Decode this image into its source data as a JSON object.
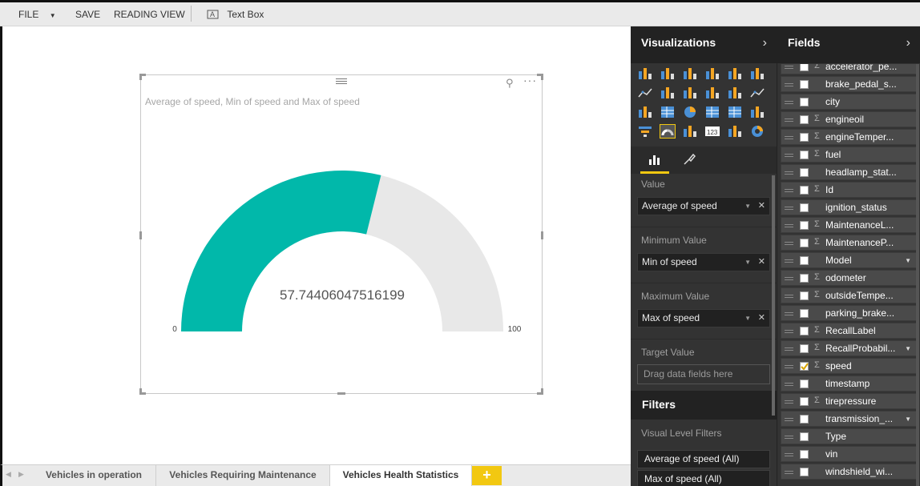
{
  "toolbar": {
    "file_label": "FILE",
    "save_label": "SAVE",
    "reading_view_label": "READING VIEW",
    "textbox_label": "Text Box"
  },
  "visual": {
    "title": "Average of speed, Min of speed and Max of speed",
    "gauge": {
      "value": 57.74406047516199,
      "value_label": "57.74406047516199",
      "min": 0,
      "max": 100,
      "min_label": "0",
      "max_label": "100",
      "fill_color": "#01b8aa",
      "track_color": "#e8e8e8"
    }
  },
  "tabs": {
    "items": [
      "Vehicles in operation",
      "Vehicles Requiring Maintenance",
      "Vehicles Health Statistics"
    ],
    "active_index": 2,
    "add_label": "+"
  },
  "visualizations": {
    "title": "Visualizations",
    "chevron": "›",
    "value_label": "Value",
    "value_field": "Average of speed",
    "min_label": "Minimum Value",
    "min_field": "Min of speed",
    "max_label": "Maximum Value",
    "max_field": "Max of speed",
    "target_label": "Target Value",
    "target_placeholder": "Drag data fields here",
    "filters_title": "Filters",
    "visual_level_label": "Visual Level Filters",
    "filters": [
      "Average of speed (All)",
      "Max of speed (All)"
    ]
  },
  "fields": {
    "title": "Fields",
    "chevron": "›",
    "items": [
      {
        "name": "accelerator_pe...",
        "sigma": true,
        "checked": false,
        "expand": false
      },
      {
        "name": "brake_pedal_s...",
        "sigma": false,
        "checked": false,
        "expand": false
      },
      {
        "name": "city",
        "sigma": false,
        "checked": false,
        "expand": false
      },
      {
        "name": "engineoil",
        "sigma": true,
        "checked": false,
        "expand": false
      },
      {
        "name": "engineTemper...",
        "sigma": true,
        "checked": false,
        "expand": false
      },
      {
        "name": "fuel",
        "sigma": true,
        "checked": false,
        "expand": false
      },
      {
        "name": "headlamp_stat...",
        "sigma": false,
        "checked": false,
        "expand": false
      },
      {
        "name": "Id",
        "sigma": true,
        "checked": false,
        "expand": false
      },
      {
        "name": "ignition_status",
        "sigma": false,
        "checked": false,
        "expand": false
      },
      {
        "name": "MaintenanceL...",
        "sigma": true,
        "checked": false,
        "expand": false
      },
      {
        "name": "MaintenanceP...",
        "sigma": true,
        "checked": false,
        "expand": false
      },
      {
        "name": "Model",
        "sigma": false,
        "checked": false,
        "expand": true
      },
      {
        "name": "odometer",
        "sigma": true,
        "checked": false,
        "expand": false
      },
      {
        "name": "outsideTempe...",
        "sigma": true,
        "checked": false,
        "expand": false
      },
      {
        "name": "parking_brake...",
        "sigma": false,
        "checked": false,
        "expand": false
      },
      {
        "name": "RecallLabel",
        "sigma": true,
        "checked": false,
        "expand": false
      },
      {
        "name": "RecallProbabil...",
        "sigma": true,
        "checked": false,
        "expand": true
      },
      {
        "name": "speed",
        "sigma": true,
        "checked": true,
        "expand": false
      },
      {
        "name": "timestamp",
        "sigma": false,
        "checked": false,
        "expand": false
      },
      {
        "name": "tirepressure",
        "sigma": true,
        "checked": false,
        "expand": false
      },
      {
        "name": "transmission_...",
        "sigma": false,
        "checked": false,
        "expand": true
      },
      {
        "name": "Type",
        "sigma": false,
        "checked": false,
        "expand": false
      },
      {
        "name": "vin",
        "sigma": false,
        "checked": false,
        "expand": false
      },
      {
        "name": "windshield_wi...",
        "sigma": false,
        "checked": false,
        "expand": false
      }
    ]
  },
  "colors": {
    "accent": "#f2c811",
    "gauge_fill": "#01b8aa",
    "pane_bg": "#333333"
  }
}
